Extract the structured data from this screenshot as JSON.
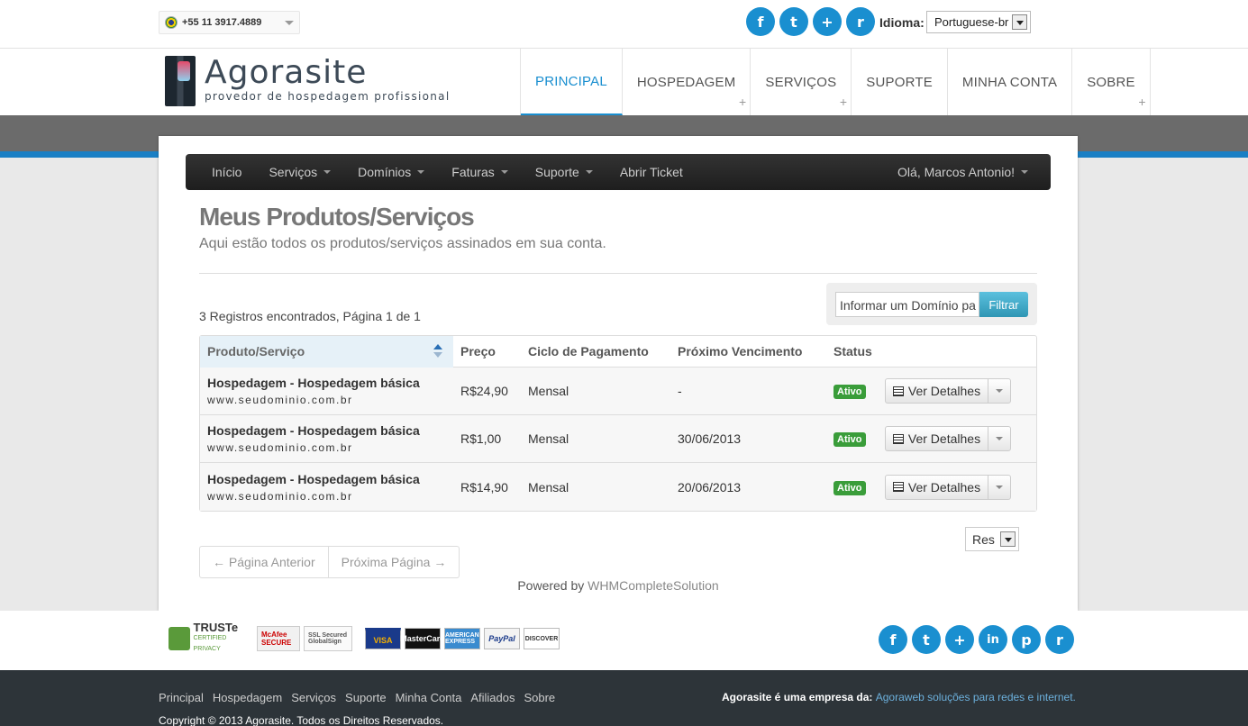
{
  "topbar": {
    "phone": "+55 11 3917.4889",
    "lang_label": "Idioma:",
    "lang_value": "Portuguese-br",
    "social_icons": [
      "facebook-icon",
      "twitter-icon",
      "googleplus-icon",
      "rss-icon"
    ],
    "social_glyphs": [
      "f",
      "t",
      "+",
      "r"
    ]
  },
  "header": {
    "logo_name": "Agorasite",
    "logo_tagline": "provedor de hospedagem profissional",
    "nav": [
      {
        "label": "PRINCIPAL",
        "active": true,
        "plus": false
      },
      {
        "label": "HOSPEDAGEM",
        "active": false,
        "plus": true
      },
      {
        "label": "SERVIÇOS",
        "active": false,
        "plus": true
      },
      {
        "label": "SUPORTE",
        "active": false,
        "plus": false
      },
      {
        "label": "MINHA CONTA",
        "active": false,
        "plus": false
      },
      {
        "label": "SOBRE",
        "active": false,
        "plus": true
      }
    ]
  },
  "subnav": {
    "items": [
      {
        "label": "Início",
        "caret": false
      },
      {
        "label": "Serviços",
        "caret": true
      },
      {
        "label": "Domínios",
        "caret": true
      },
      {
        "label": "Faturas",
        "caret": true
      },
      {
        "label": "Suporte",
        "caret": true
      },
      {
        "label": "Abrir Ticket",
        "caret": false
      }
    ],
    "user": "Olá, Marcos Antonio!"
  },
  "page": {
    "title": "Meus Produtos/Serviços",
    "subtitle": "Aqui estão todos os produtos/serviços assinados em sua conta.",
    "records": "3 Registros encontrados, Página 1 de 1",
    "filter_placeholder": "Informar um Domínio pa",
    "filter_button": "Filtrar"
  },
  "table": {
    "headers": [
      "Produto/Serviço",
      "Preço",
      "Ciclo de Pagamento",
      "Próximo Vencimento",
      "Status"
    ],
    "rows": [
      {
        "product": "Hospedagem - Hospedagem básica",
        "domain": "www.seudominio.com.br",
        "price": "R$24,90",
        "cycle": "Mensal",
        "due": "-",
        "status": "Ativo",
        "action": "Ver Detalhes"
      },
      {
        "product": "Hospedagem - Hospedagem básica",
        "domain": "www.seudominio.com.br",
        "price": "R$1,00",
        "cycle": "Mensal",
        "due": "30/06/2013",
        "status": "Ativo",
        "action": "Ver Detalhes"
      },
      {
        "product": "Hospedagem - Hospedagem básica",
        "domain": "www.seudominio.com.br",
        "price": "R$14,90",
        "cycle": "Mensal",
        "due": "20/06/2013",
        "status": "Ativo",
        "action": "Ver Detalhes"
      }
    ]
  },
  "pagination": {
    "prev": "← Página Anterior",
    "next": "Próxima Página →",
    "per_page": "Res"
  },
  "powered": {
    "prefix": "Powered by",
    "link": "WHMCompleteSolution"
  },
  "footer": {
    "seals": [
      "TRUSTe",
      "McAfee SECURE",
      "SSL Secured GlobalSign"
    ],
    "truste_sub": "CERTIFIED PRIVACY",
    "cards": [
      "VISA",
      "MasterCard",
      "AMERICAN EXPRESS",
      "PayPal",
      "DISCOVER"
    ],
    "social_icons": [
      "facebook-icon",
      "twitter-icon",
      "googleplus-icon",
      "linkedin-icon",
      "pinterest-icon",
      "rss-icon"
    ],
    "social_glyphs": [
      "f",
      "t",
      "+",
      "in",
      "p",
      "r"
    ],
    "links": [
      "Principal",
      "Hospedagem",
      "Serviços",
      "Suporte",
      "Minha Conta",
      "Afiliados",
      "Sobre"
    ],
    "company_prefix": "Agorasite é uma empresa da:",
    "company_link": "Agoraweb soluções para redes e internet.",
    "copyright": "Copyright © 2013 Agorasite. Todos os Direitos Reservados."
  },
  "colors": {
    "accent": "#1a8fd0",
    "status_active": "#3a9d3a",
    "footer_dark": "#2d3439"
  }
}
